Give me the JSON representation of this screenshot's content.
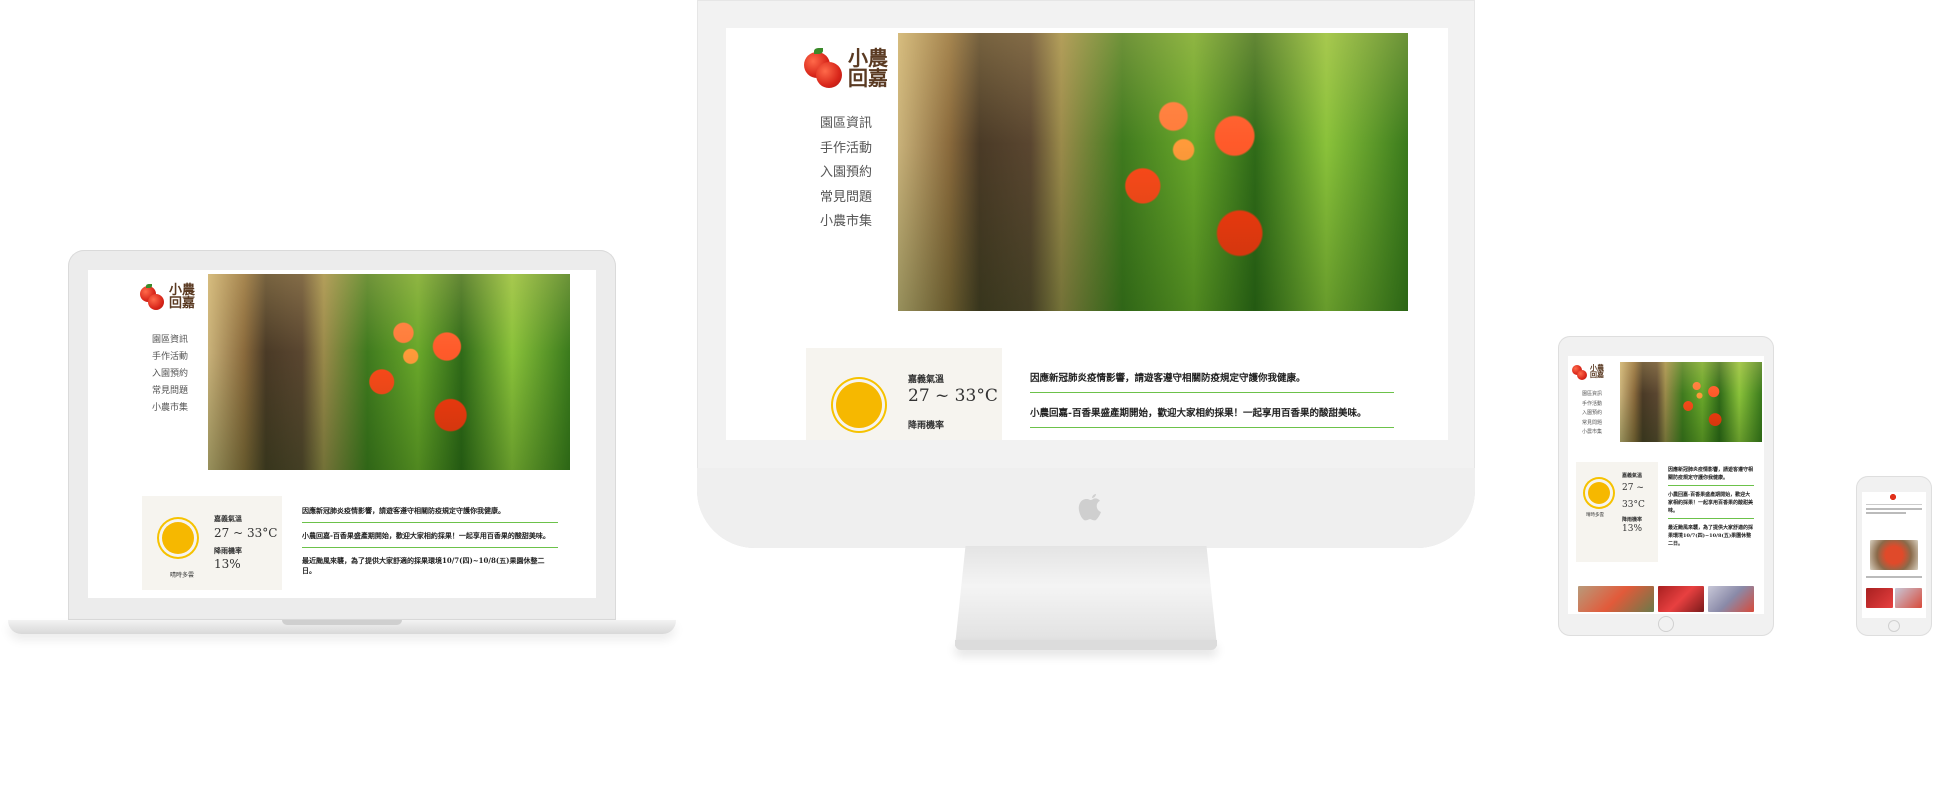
{
  "site": {
    "logo_line1": "小農",
    "logo_line2": "回嘉",
    "nav": [
      "園區資訊",
      "手作活動",
      "入園預約",
      "常見問題",
      "小農市集"
    ]
  },
  "weather": {
    "city": "嘉義氣溫",
    "temp": "27 ~ 33°C",
    "rain_label": "降雨機率",
    "rain_value": "13%",
    "status": "晴時多雲"
  },
  "news": [
    "因應新冠肺炎疫情影響，請遊客遵守相關防疫規定守護你我健康。",
    "小農回嘉-百香果盛產期開始，歡迎大家相約採果！一起享用百香果的酸甜美味。",
    "最近颱風來襲，為了提供大家舒適的採果環境10/7(四)~10/8(五)果園休整二日。"
  ],
  "tablet_news": [
    "因應新冠肺炎疫情影響，請遊客遵守相關防疫規定守護你我健康。",
    "小農回嘉-百香果盛產期開始，歡迎大家相約採果！一起享用百香果的酸甜美味。",
    "最近颱風來襲，為了提供大家舒適的採果環境10/7(四)~10/8(五)果園休整二日。"
  ],
  "colors": {
    "accent_green": "#6cc24a",
    "logo_brown": "#5a3a22",
    "sun": "#f6b800",
    "weather_bg": "#f6f4ef"
  }
}
